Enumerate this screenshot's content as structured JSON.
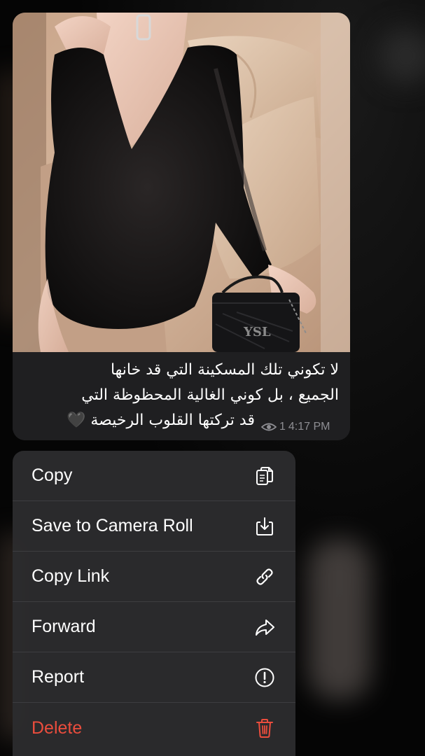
{
  "message": {
    "caption_lines": [
      "لا تكوني تلك المسكينة التي قد خانها",
      "الجميع ، بل كوني الغالية المحظوظة التي",
      "قد تركتها القلوب الرخيصة 🖤"
    ],
    "views": "1",
    "time": "4:17 PM"
  },
  "menu": {
    "items": [
      {
        "label": "Copy",
        "icon": "copy-icon"
      },
      {
        "label": "Save to Camera Roll",
        "icon": "save-icon"
      },
      {
        "label": "Copy Link",
        "icon": "link-icon"
      },
      {
        "label": "Forward",
        "icon": "forward-icon"
      },
      {
        "label": "Report",
        "icon": "report-icon"
      },
      {
        "label": "Delete",
        "icon": "trash-icon"
      }
    ],
    "danger_color": "#eb4d3d"
  }
}
